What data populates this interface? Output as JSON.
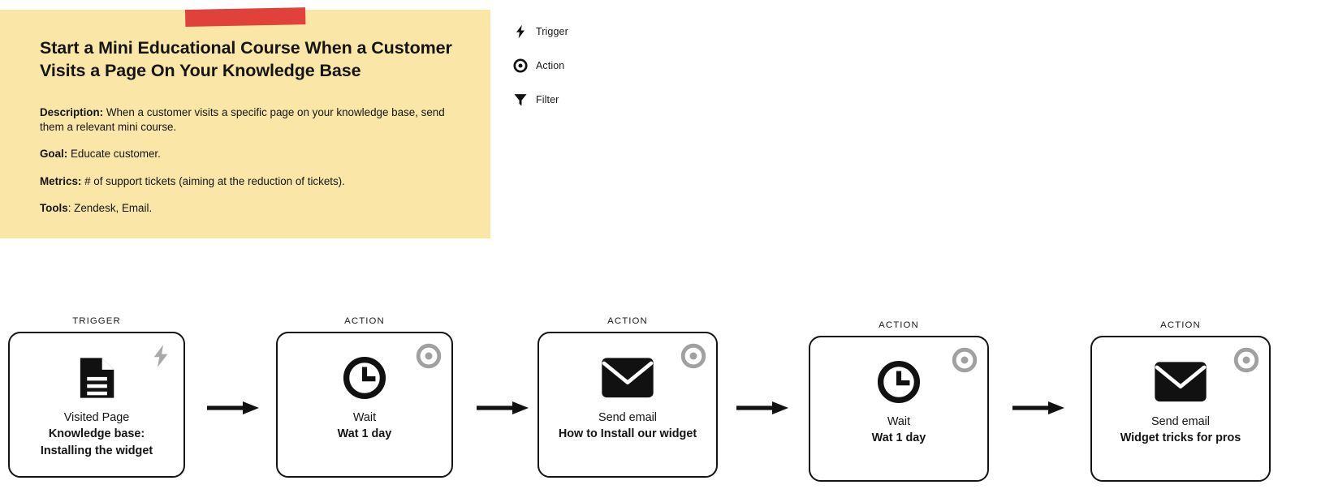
{
  "note": {
    "title": "Start a Mini Educational Course When a Customer Visits a Page On Your Knowledge Base",
    "description_label": "Description:",
    "description_text": " When a customer visits a specific page on your knowledge base, send them a relevant mini course.",
    "goal_label": "Goal:",
    "goal_text": " Educate customer.",
    "metrics_label": "Metrics:",
    "metrics_text": " # of support tickets (aiming at the reduction of tickets).",
    "tools_label": "Tools",
    "tools_text": ": Zendesk, Email.",
    "background_color": "#fae6a6",
    "tape_color": "#e0413a"
  },
  "legend": {
    "items": [
      {
        "icon": "lightning-bolt-icon",
        "label": "Trigger"
      },
      {
        "icon": "target-circle-icon",
        "label": "Action"
      },
      {
        "icon": "funnel-icon",
        "label": "Filter"
      }
    ]
  },
  "flow": {
    "arrow_label": "arrow-right",
    "nodes": [
      {
        "kind": "TRIGGER",
        "badge": "lightning-bolt-icon",
        "badge_color": "#a9a9a9",
        "glyph": "document-icon",
        "line1": "Visited Page",
        "line2": "Knowledge base:",
        "line3": "Installing the widget"
      },
      {
        "kind": "ACTION",
        "badge": "target-circle-icon",
        "badge_color": "#a0a0a0",
        "glyph": "clock-icon",
        "line1": "Wait",
        "line2": "Wat 1 day",
        "line3": ""
      },
      {
        "kind": "ACTION",
        "badge": "target-circle-icon",
        "badge_color": "#a0a0a0",
        "glyph": "envelope-icon",
        "line1": "Send email",
        "line2": "How to Install our widget",
        "line3": ""
      },
      {
        "kind": "ACTION",
        "badge": "target-circle-icon",
        "badge_color": "#a0a0a0",
        "glyph": "clock-icon",
        "line1": "Wait",
        "line2": "Wat 1 day",
        "line3": ""
      },
      {
        "kind": "ACTION",
        "badge": "target-circle-icon",
        "badge_color": "#a0a0a0",
        "glyph": "envelope-icon",
        "line1": "Send email",
        "line2": "Widget tricks for pros",
        "line3": ""
      }
    ]
  }
}
